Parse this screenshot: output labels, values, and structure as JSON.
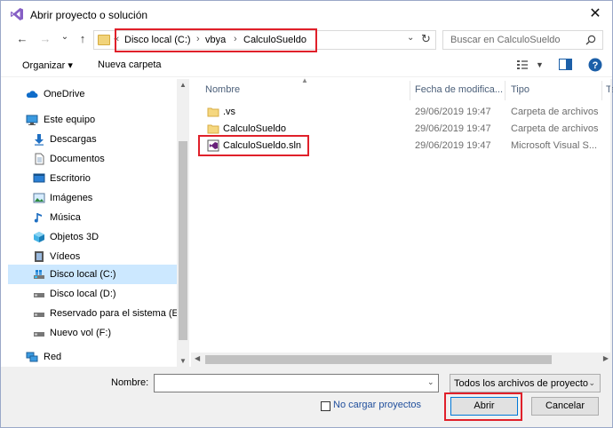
{
  "window": {
    "title": "Abrir proyecto o solución",
    "close_glyph": "✕"
  },
  "nav": {
    "back_glyph": "←",
    "forward_glyph": "→",
    "recent_glyph": "⌄",
    "up_glyph": "↑"
  },
  "address": {
    "lead": "«",
    "segments": [
      "Disco local (C:)",
      "vbya",
      "CalculoSueldo"
    ],
    "separator": "›",
    "dropdown_glyph": "⌄",
    "refresh_glyph": "↻"
  },
  "search": {
    "placeholder": "Buscar en CalculoSueldo"
  },
  "toolbar": {
    "organize_label": "Organizar ▾",
    "new_folder_label": "Nueva carpeta",
    "help_glyph": "?"
  },
  "sidebar": {
    "items": [
      {
        "label": "OneDrive",
        "icon": "cloud-icon",
        "level": "top"
      },
      {
        "label": "Este equipo",
        "icon": "computer-icon",
        "level": "top"
      },
      {
        "label": "Descargas",
        "icon": "download-icon",
        "level": "sub"
      },
      {
        "label": "Documentos",
        "icon": "document-icon",
        "level": "sub"
      },
      {
        "label": "Escritorio",
        "icon": "desktop-icon",
        "level": "sub"
      },
      {
        "label": "Imágenes",
        "icon": "image-icon",
        "level": "sub"
      },
      {
        "label": "Música",
        "icon": "music-icon",
        "level": "sub"
      },
      {
        "label": "Objetos 3D",
        "icon": "cube-icon",
        "level": "sub"
      },
      {
        "label": "Vídeos",
        "icon": "video-icon",
        "level": "sub"
      },
      {
        "label": "Disco local (C:)",
        "icon": "drive-icon",
        "level": "sub",
        "selected": true
      },
      {
        "label": "Disco local (D:)",
        "icon": "drive-icon",
        "level": "sub"
      },
      {
        "label": "Reservado para el sistema (E:)",
        "icon": "drive-icon",
        "level": "sub"
      },
      {
        "label": "Nuevo vol (F:)",
        "icon": "drive-icon",
        "level": "sub"
      },
      {
        "label": "Red",
        "icon": "network-icon",
        "level": "top"
      }
    ]
  },
  "filelist": {
    "columns": [
      "Nombre",
      "Fecha de modifica...",
      "Tipo",
      "Ta"
    ],
    "rows": [
      {
        "name": ".vs",
        "date": "29/06/2019 19:47",
        "type": "Carpeta de archivos",
        "icon": "folder-icon"
      },
      {
        "name": "CalculoSueldo",
        "date": "29/06/2019 19:47",
        "type": "Carpeta de archivos",
        "icon": "folder-icon"
      },
      {
        "name": "CalculoSueldo.sln",
        "date": "29/06/2019 19:47",
        "type": "Microsoft Visual S...",
        "icon": "solution-file-icon"
      }
    ]
  },
  "bottom": {
    "name_label": "Nombre:",
    "name_value": "",
    "filter_label": "Todos los archivos de proyecto",
    "no_load_label": "No cargar proyectos",
    "open_label": "Abrir",
    "cancel_label": "Cancelar"
  },
  "colors": {
    "highlight": "#e0202a",
    "selection": "#cce8ff",
    "accent": "#0078d7"
  }
}
